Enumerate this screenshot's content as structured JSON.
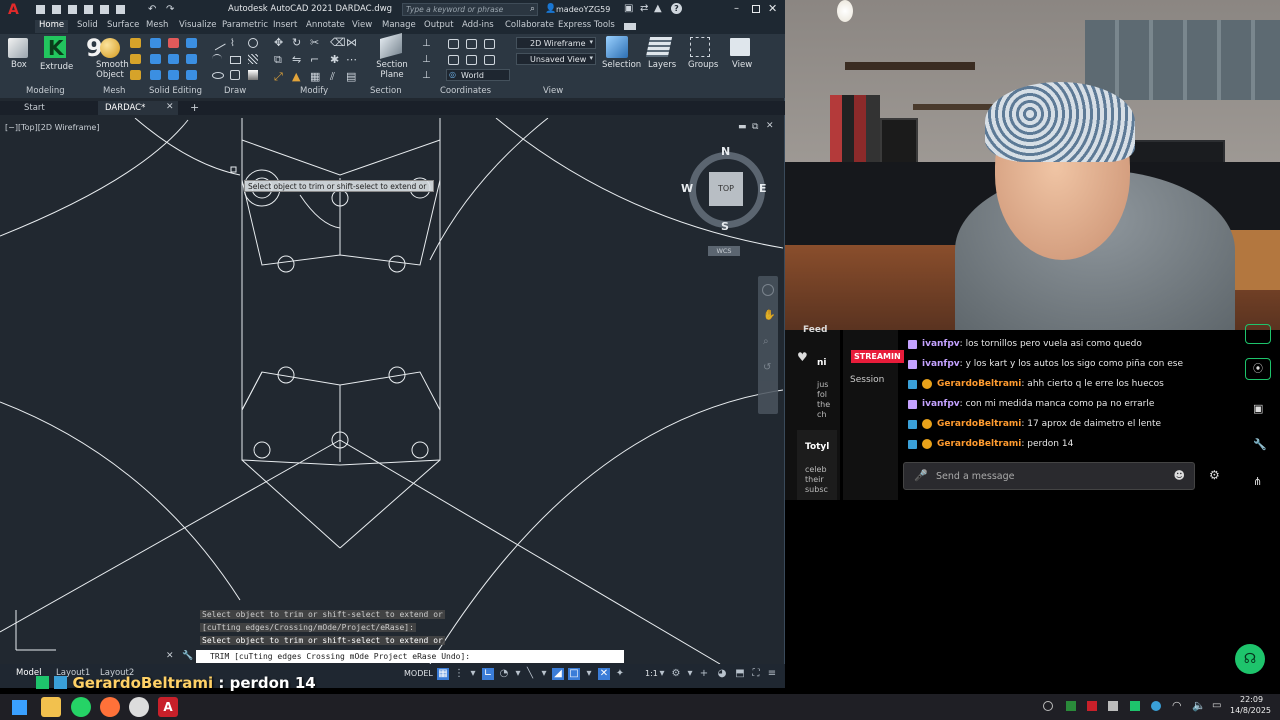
{
  "autocad": {
    "title": "Autodesk AutoCAD 2021   DARDAC.dwg",
    "search_placeholder": "Type a keyword or phrase",
    "user": "madeoYZG59",
    "ribbon_tabs": [
      "Home",
      "Solid",
      "Surface",
      "Mesh",
      "Visualize",
      "Parametric",
      "Insert",
      "Annotate",
      "View",
      "Manage",
      "Output",
      "Add-ins",
      "Collaborate",
      "Express Tools"
    ],
    "buttons": {
      "box": "Box",
      "extrude": "Extrude",
      "smooth_object": "Smooth Object",
      "section_plane": "Section Plane",
      "selection": "Selection",
      "layers": "Layers",
      "groups": "Groups",
      "view": "View"
    },
    "panel_titles": {
      "modeling": "Modeling",
      "mesh": "Mesh",
      "solid_editing": "Solid Editing",
      "draw": "Draw",
      "modify": "Modify",
      "section": "Section",
      "coordinates": "Coordinates",
      "view": "View"
    },
    "visual_style": "2D Wireframe",
    "saved_view": "Unsaved View",
    "ucs": "World",
    "overlay_count": "9",
    "file_tabs": {
      "start": "Start",
      "active": "DARDAC*"
    },
    "viewport_label": "[−][Top][2D Wireframe]",
    "viewcube": {
      "n": "N",
      "s": "S",
      "e": "E",
      "w": "W",
      "top": "TOP",
      "wcs": "WCS"
    },
    "tooltip": "Select object to trim or shift-select to extend or",
    "history": [
      "Select object to trim or shift-select to extend or",
      "[cuTting edges/Crossing/mOde/Project/eRase]:",
      "Select object to trim or shift-select to extend or"
    ],
    "command": "TRIM [cuTting edges Crossing mOde Project eRase Undo]:",
    "layout_tabs": {
      "model": "Model",
      "layout1": "Layout1",
      "layout2": "Layout2"
    },
    "status_model": "MODEL",
    "status_scale": "1:1"
  },
  "chat": {
    "side_labels": {
      "feed": "Feed",
      "streaming": "STREAMIN",
      "session": "Session",
      "totyl": "Totyl",
      "n": "ni",
      "celebrate": "celeb\ntheir\nsubsc",
      "jus": "jus\nfol\nthe\nch"
    },
    "messages": [
      {
        "user": "ivanfpv",
        "text": ": los tornillos pero vuela asi como quedo",
        "color": "purple",
        "badges": 1
      },
      {
        "user": "ivanfpv",
        "text": ": y los kart y los autos los sigo como piña con ese",
        "color": "purple",
        "badges": 1
      },
      {
        "user": "GerardoBeltrami",
        "text": ": ahh cierto q le erre los huecos",
        "color": "orange",
        "badges": 2
      },
      {
        "user": "ivanfpv",
        "text": ": con mi medida manca como pa no errarle",
        "color": "purple",
        "badges": 1
      },
      {
        "user": "GerardoBeltrami",
        "text": ": 17 aprox de daimetro el lente",
        "color": "orange",
        "badges": 2
      },
      {
        "user": "GerardoBeltrami",
        "text": ": perdon 14",
        "color": "orange",
        "badges": 2
      }
    ],
    "input_placeholder": "Send a message"
  },
  "overlay": {
    "user": "GerardoBeltrami",
    "text": ": perdon 14"
  },
  "taskbar": {
    "time": "22:09",
    "date": "14/8/2025"
  },
  "colors": {
    "viewport_bg": "#212830",
    "ribbon_bg": "#2c3742",
    "line": "#e8ecef",
    "orange_user": "#ff9b2f",
    "purple_user": "#c4a2ff",
    "green_button": "#1ec46c"
  }
}
